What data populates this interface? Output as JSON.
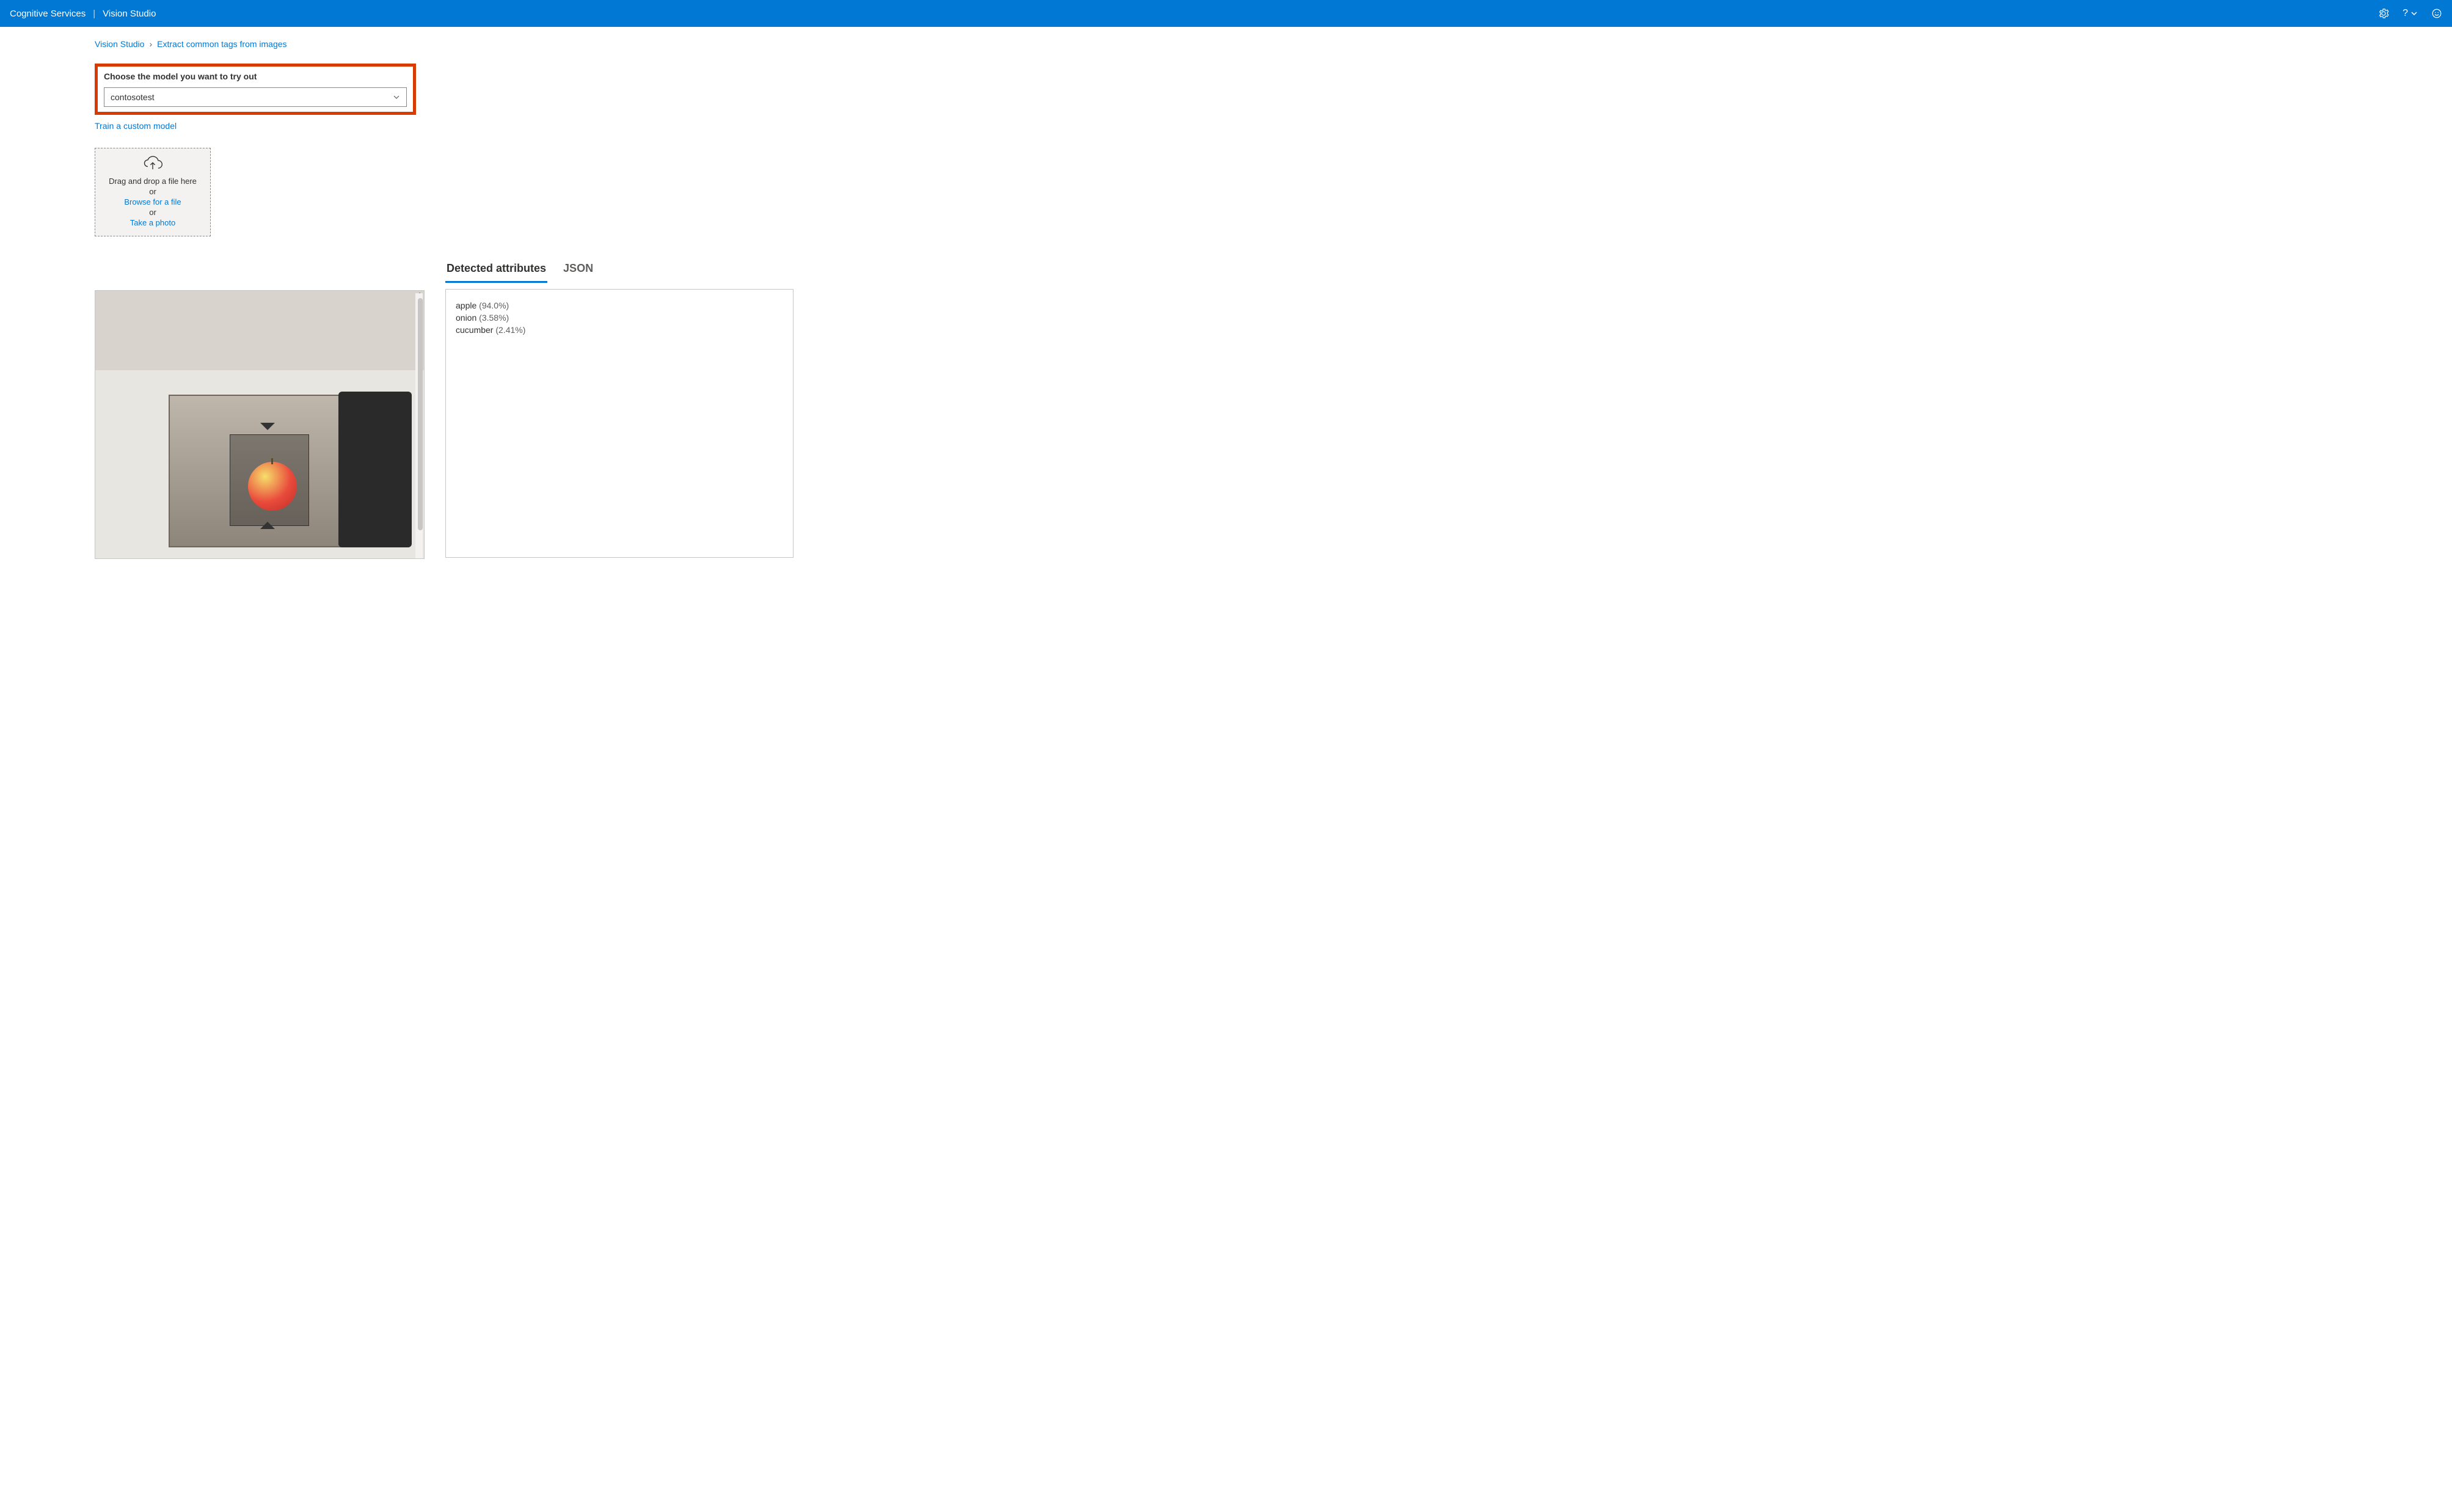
{
  "header": {
    "service": "Cognitive Services",
    "product": "Vision Studio"
  },
  "breadcrumb": {
    "root": "Vision Studio",
    "current": "Extract common tags from images"
  },
  "model_chooser": {
    "label": "Choose the model you want to try out",
    "selected": "contosotest",
    "train_link": "Train a custom model"
  },
  "dropzone": {
    "drag_text": "Drag and drop a file here",
    "or1": "or",
    "browse": "Browse for a file",
    "or2": "or",
    "take_photo": "Take a photo"
  },
  "tabs": {
    "detected": "Detected attributes",
    "json": "JSON"
  },
  "results": [
    {
      "name": "apple",
      "confidence": "(94.0%)"
    },
    {
      "name": "onion",
      "confidence": "(3.58%)"
    },
    {
      "name": "cucumber",
      "confidence": "(2.41%)"
    }
  ]
}
